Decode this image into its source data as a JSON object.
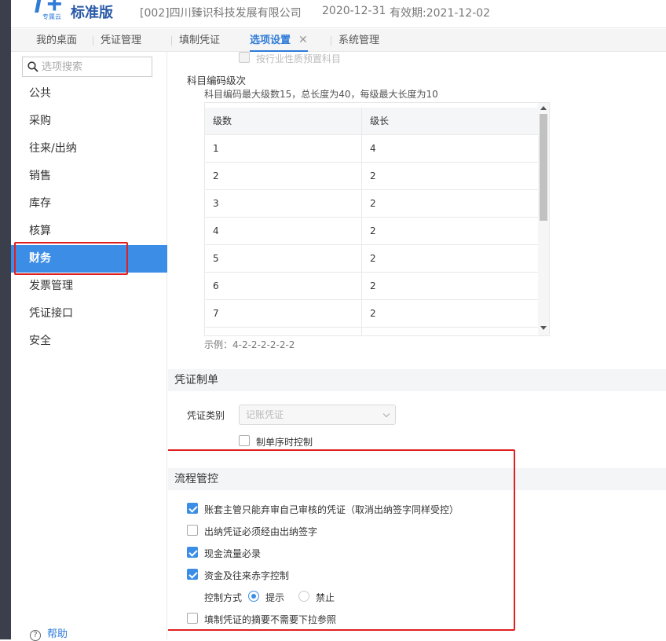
{
  "header": {
    "logo_glyph": "T+",
    "logo_sub": "专属云",
    "edition": "标准版",
    "company": "[002]四川臻识科技发展有限公司",
    "date": "2020-12-31",
    "valid": "有效期:2021-12-02"
  },
  "tabs": [
    {
      "label": "我的桌面"
    },
    {
      "label": "凭证管理"
    },
    {
      "label": "填制凭证"
    },
    {
      "label": "选项设置",
      "active": true,
      "close": "✕"
    },
    {
      "label": "系统管理"
    }
  ],
  "sidebar": {
    "search_placeholder": "选项搜索",
    "items": [
      {
        "label": "公共"
      },
      {
        "label": "采购"
      },
      {
        "label": "往来/出纳"
      },
      {
        "label": "销售"
      },
      {
        "label": "库存"
      },
      {
        "label": "核算"
      },
      {
        "label": "财务",
        "active": true
      },
      {
        "label": "发票管理"
      },
      {
        "label": "凭证接口"
      },
      {
        "label": "安全"
      }
    ],
    "help": "帮助"
  },
  "main": {
    "top_option": "按行业性质预置科目",
    "coding": {
      "title": "科目编码级次",
      "desc": "科目编码最大级数15，总长度为40，每级最大长度为10",
      "headers": [
        "级数",
        "级长"
      ],
      "rows": [
        [
          "1",
          "4"
        ],
        [
          "2",
          "2"
        ],
        [
          "3",
          "2"
        ],
        [
          "4",
          "2"
        ],
        [
          "5",
          "2"
        ],
        [
          "6",
          "2"
        ],
        [
          "7",
          "2"
        ]
      ],
      "example": "示例：4-2-2-2-2-2-2"
    },
    "voucher": {
      "title": "凭证制单",
      "type_label": "凭证类别",
      "type_value": "记账凭证",
      "seq_label": "制单序时控制"
    },
    "process": {
      "title": "流程管控",
      "options": [
        {
          "label": "账套主管只能弃审自己审核的凭证（取消出纳签字同样受控）",
          "checked": true
        },
        {
          "label": "出纳凭证必须经由出纳签字",
          "checked": false
        },
        {
          "label": "现金流量必录",
          "checked": true
        },
        {
          "label": "资金及往来赤字控制",
          "checked": true
        }
      ],
      "control_label": "控制方式",
      "radio_prompt": "提示",
      "radio_forbid": "禁止",
      "last_option": {
        "label": "填制凭证的摘要不需要下拉参照",
        "checked": false
      }
    }
  },
  "colors": {
    "accent": "#3b8de6",
    "highlight": "#e02020"
  }
}
